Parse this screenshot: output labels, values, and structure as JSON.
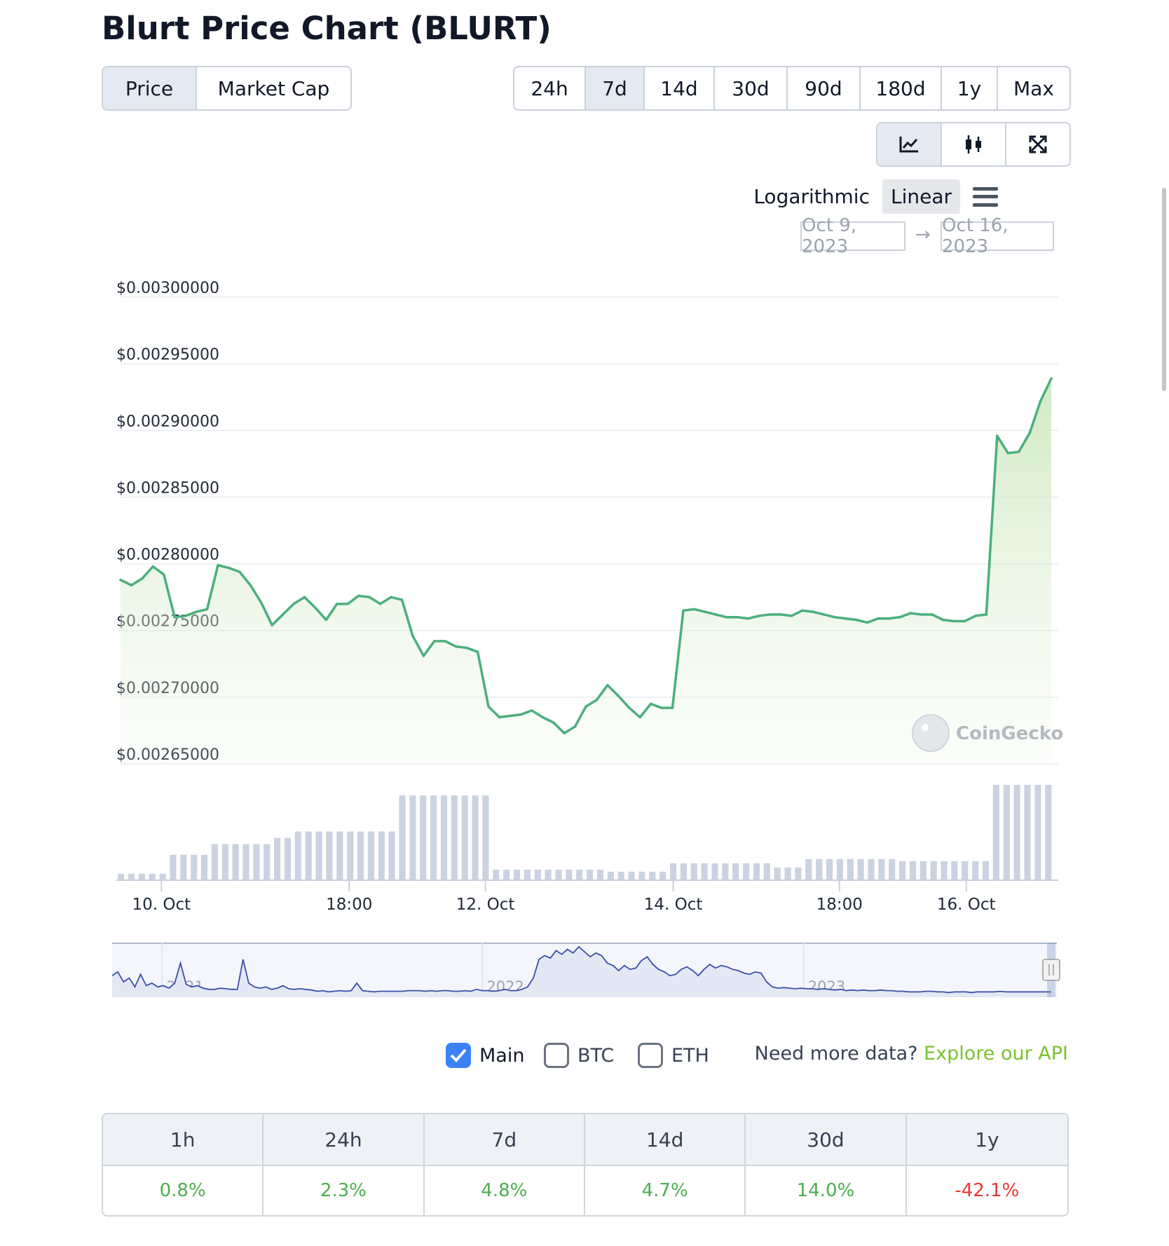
{
  "title": "Blurt Price Chart (BLURT)",
  "view_tabs": [
    {
      "label": "Price",
      "active": true
    },
    {
      "label": "Market Cap",
      "active": false
    }
  ],
  "ranges": [
    {
      "label": "24h",
      "active": false
    },
    {
      "label": "7d",
      "active": true
    },
    {
      "label": "14d",
      "active": false
    },
    {
      "label": "30d",
      "active": false
    },
    {
      "label": "90d",
      "active": false
    },
    {
      "label": "180d",
      "active": false
    },
    {
      "label": "1y",
      "active": false
    },
    {
      "label": "Max",
      "active": false
    }
  ],
  "chart_type_icons": [
    "line-chart-icon",
    "candlestick-icon",
    "fullscreen-icon"
  ],
  "scale": {
    "logarithmic": "Logarithmic",
    "linear": "Linear",
    "active": "Linear"
  },
  "date_range": {
    "from": "Oct 9, 2023",
    "arrow": "→",
    "to": "Oct 16, 2023"
  },
  "watermark": "CoinGecko",
  "colors": {
    "line": "#4caf7d",
    "volume": "#ccd3e0",
    "navigator": "#3a4fa8",
    "positive": "#4caf50",
    "negative": "#e53935",
    "api_link": "#7ac231"
  },
  "chart_data": {
    "type": "area",
    "ylim": [
      0.00265,
      0.003
    ],
    "y_ticks": [
      "$0.00300000",
      "$0.00295000",
      "$0.00290000",
      "$0.00285000",
      "$0.00280000",
      "$0.00275000",
      "$0.00270000",
      "$0.00265000"
    ],
    "x_tick_labels": [
      "10. Oct",
      "18:00",
      "12. Oct",
      "14. Oct",
      "18:00",
      "16. Oct"
    ],
    "prices": [
      0.002788,
      0.002784,
      0.002789,
      0.002798,
      0.002792,
      0.00276,
      0.002761,
      0.002764,
      0.002766,
      0.002799,
      0.002797,
      0.002794,
      0.002784,
      0.002771,
      0.002754,
      0.002762,
      0.00277,
      0.002775,
      0.002767,
      0.002758,
      0.00277,
      0.00277,
      0.002776,
      0.002775,
      0.00277,
      0.002775,
      0.002773,
      0.002746,
      0.002731,
      0.002742,
      0.002742,
      0.002738,
      0.002737,
      0.002734,
      0.002693,
      0.002685,
      0.002686,
      0.002687,
      0.00269,
      0.002685,
      0.002681,
      0.002673,
      0.002678,
      0.002693,
      0.002698,
      0.002709,
      0.002701,
      0.002692,
      0.002685,
      0.002695,
      0.002692,
      0.002692,
      0.002765,
      0.002766,
      0.002764,
      0.002762,
      0.00276,
      0.00276,
      0.002759,
      0.002761,
      0.002762,
      0.002762,
      0.002761,
      0.002765,
      0.002764,
      0.002762,
      0.00276,
      0.002759,
      0.002758,
      0.002756,
      0.002759,
      0.002759,
      0.00276,
      0.002763,
      0.002762,
      0.002762,
      0.002758,
      0.002757,
      0.002757,
      0.002761,
      0.002762,
      0.002896,
      0.002883,
      0.002884,
      0.002898,
      0.002922,
      0.002939
    ],
    "volume": [
      3,
      3,
      3,
      3,
      3,
      12,
      12,
      12,
      12,
      17,
      17,
      17,
      17,
      17,
      17,
      20,
      20,
      23,
      23,
      23,
      23,
      23,
      23,
      23,
      23,
      23,
      23,
      40,
      40,
      40,
      40,
      40,
      40,
      40,
      40,
      40,
      5,
      5,
      5,
      5,
      5,
      5,
      5,
      5,
      5,
      5,
      5,
      4,
      4,
      4,
      4,
      4,
      4,
      8,
      8,
      8,
      8,
      8,
      8,
      8,
      8,
      8,
      8,
      6,
      6,
      6,
      10,
      10,
      10,
      10,
      10,
      10,
      10,
      10,
      10,
      9,
      9,
      9,
      9,
      9,
      9,
      9,
      9,
      9,
      45,
      45,
      45,
      45,
      45,
      45
    ],
    "navigator": {
      "year_labels": [
        "2021",
        "2022",
        "2023"
      ],
      "values": [
        30,
        36,
        20,
        26,
        12,
        32,
        14,
        18,
        12,
        14,
        10,
        18,
        50,
        16,
        12,
        14,
        10,
        8,
        8,
        10,
        9,
        8,
        8,
        56,
        18,
        12,
        10,
        12,
        8,
        10,
        14,
        9,
        8,
        9,
        8,
        7,
        5,
        6,
        4,
        5,
        6,
        5,
        6,
        18,
        6,
        5,
        4,
        5,
        5,
        5,
        5,
        5,
        6,
        6,
        6,
        5,
        6,
        5,
        6,
        6,
        5,
        5,
        6,
        5,
        8,
        6,
        6,
        5,
        6,
        8,
        6,
        6,
        8,
        12,
        26,
        56,
        62,
        58,
        70,
        64,
        72,
        66,
        76,
        68,
        60,
        66,
        62,
        50,
        46,
        38,
        46,
        40,
        42,
        54,
        60,
        48,
        40,
        36,
        30,
        32,
        40,
        44,
        38,
        30,
        40,
        48,
        42,
        46,
        44,
        40,
        38,
        34,
        32,
        36,
        34,
        20,
        12,
        10,
        11,
        10,
        9,
        10,
        9,
        9,
        8,
        9,
        8,
        7,
        8,
        6,
        7,
        6,
        7,
        6,
        6,
        7,
        6,
        6,
        5,
        5,
        4,
        4,
        4,
        5,
        5,
        4,
        4,
        3,
        4,
        4,
        4,
        3,
        4,
        4,
        4,
        4,
        5,
        4,
        4,
        4,
        4,
        4,
        4,
        4,
        4,
        4
      ]
    }
  },
  "series_toggles": [
    {
      "label": "Main",
      "checked": true
    },
    {
      "label": "BTC",
      "checked": false
    },
    {
      "label": "ETH",
      "checked": false
    }
  ],
  "api_prompt": {
    "text": "Need more data?",
    "link": "Explore our API"
  },
  "performance": {
    "headers": [
      "1h",
      "24h",
      "7d",
      "14d",
      "30d",
      "1y"
    ],
    "values": [
      {
        "text": "0.8%",
        "trend": "up"
      },
      {
        "text": "2.3%",
        "trend": "up"
      },
      {
        "text": "4.8%",
        "trend": "up"
      },
      {
        "text": "4.7%",
        "trend": "up"
      },
      {
        "text": "14.0%",
        "trend": "up"
      },
      {
        "text": "-42.1%",
        "trend": "down"
      }
    ]
  }
}
